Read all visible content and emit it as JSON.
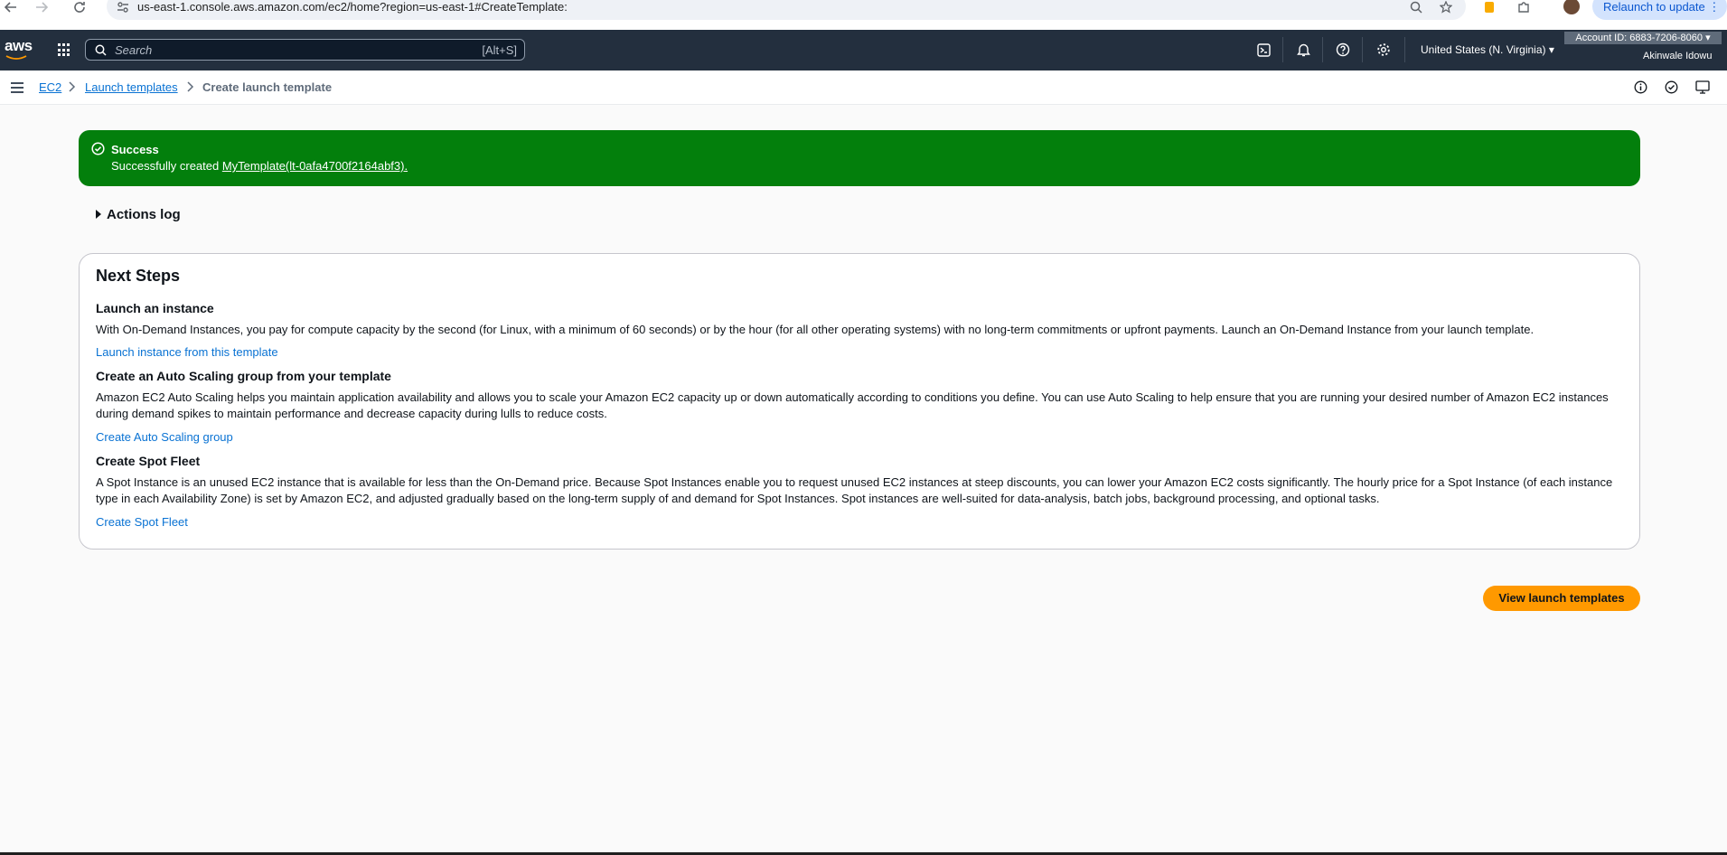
{
  "browser": {
    "url": "us-east-1.console.aws.amazon.com/ec2/home?region=us-east-1#CreateTemplate:",
    "relaunch_label": "Relaunch to update"
  },
  "aws_nav": {
    "logo": "aws",
    "search_placeholder": "Search",
    "search_shortcut": "[Alt+S]",
    "region": "United States (N. Virginia) ▾",
    "account": "Account ID: 6883-7206-8060 ▾",
    "user": "Akinwale Idowu"
  },
  "breadcrumb": {
    "items": [
      "EC2",
      "Launch templates"
    ],
    "current": "Create launch template"
  },
  "flash": {
    "title": "Success",
    "message_prefix": "Successfully created ",
    "message_link": "MyTemplate(lt-0afa4700f2164abf3).",
    "color": "#037f0c"
  },
  "actions_log": {
    "label": "Actions log"
  },
  "next_steps": {
    "title": "Next Steps",
    "sections": [
      {
        "heading": "Launch an instance",
        "body": "With On-Demand Instances, you pay for compute capacity by the second (for Linux, with a minimum of 60 seconds) or by the hour (for all other operating systems) with no long-term commitments or upfront payments. Launch an On-Demand Instance from your launch template.",
        "link": "Launch instance from this template"
      },
      {
        "heading": "Create an Auto Scaling group from your template",
        "body": "Amazon EC2 Auto Scaling helps you maintain application availability and allows you to scale your Amazon EC2 capacity up or down automatically according to conditions you define. You can use Auto Scaling to help ensure that you are running your desired number of Amazon EC2 instances during demand spikes to maintain performance and decrease capacity during lulls to reduce costs.",
        "link": "Create Auto Scaling group"
      },
      {
        "heading": "Create Spot Fleet",
        "body": "A Spot Instance is an unused EC2 instance that is available for less than the On-Demand price. Because Spot Instances enable you to request unused EC2 instances at steep discounts, you can lower your Amazon EC2 costs significantly. The hourly price for a Spot Instance (of each instance type in each Availability Zone) is set by Amazon EC2, and adjusted gradually based on the long-term supply of and demand for Spot Instances. Spot instances are well-suited for data-analysis, batch jobs, background processing, and optional tasks.",
        "link": "Create Spot Fleet"
      }
    ]
  },
  "primary_button": {
    "label": "View launch templates",
    "color": "#ff9900"
  }
}
